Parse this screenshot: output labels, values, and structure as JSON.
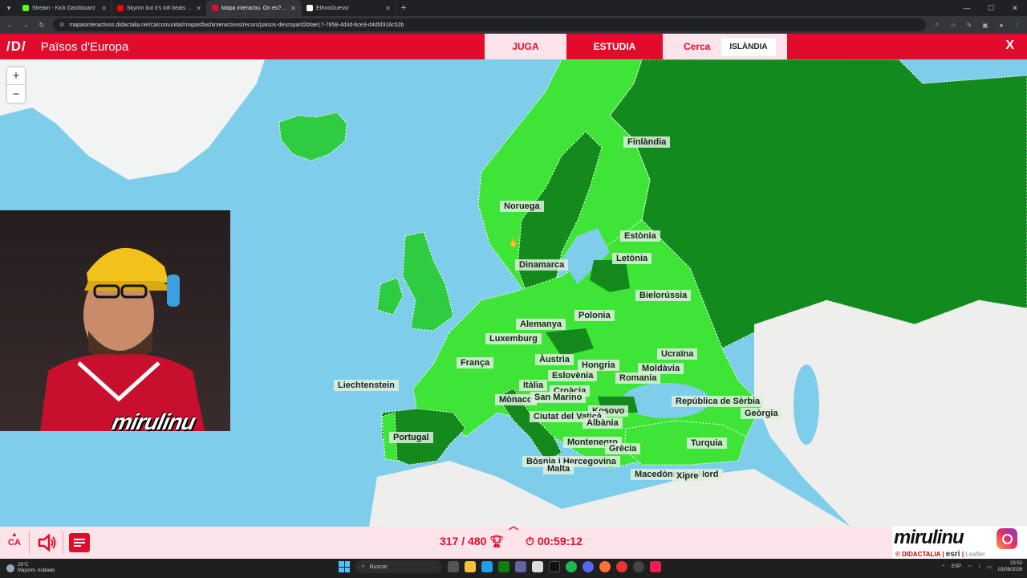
{
  "browser": {
    "tabs": [
      {
        "title": "Stream - Kick Dashboard",
        "color": "#53fc18",
        "active": false
      },
      {
        "title": "Skyrim but it's lofi beats | N",
        "color": "#ff0000",
        "active": false
      },
      {
        "title": "Mapa interactiu. On és? Països",
        "color": "#e10c2c",
        "active": true
      },
      {
        "title": "EthnoGuessr",
        "color": "#ffffff",
        "active": false
      }
    ],
    "url": "mapasinteractivos.didactalia.net/ca/comunitat/mapasflashinteractivos/recurs/paisos-deuropa/d2bfae17-7658-4d3d-bce3-d4d5f316c52b"
  },
  "app": {
    "logo": "/D/",
    "title": "Països d'Europa",
    "modes": {
      "play": "JUGA",
      "study": "ESTUDIA",
      "search": "Cerca"
    },
    "search_target": "ISLÀNDIA",
    "close": "X"
  },
  "map": {
    "zoom_in": "+",
    "zoom_out": "−",
    "labels": [
      "Finlàndia",
      "Noruega",
      "Estònia",
      "Letònia",
      "Dinamarca",
      "Bielorússia",
      "Polonia",
      "Alemanya",
      "Luxemburg",
      "Ucraïna",
      "Àustria",
      "Hongria",
      "França",
      "Moldàvia",
      "Eslovènia",
      "Liechtenstein",
      "Romania",
      "Itàlia",
      "Croàcia",
      "República de Sèrbia",
      "Mònaco",
      "San Marino",
      "Geòrgia",
      "Kosovo",
      "Ciutat del Vaticà",
      "Albània",
      "Portugal",
      "Montenegro",
      "Grècia",
      "Turquia",
      "Bòsnia i Hercegovina",
      "Malta",
      "Macedònia del Nord",
      "Xipre"
    ]
  },
  "overlay": {
    "streamer": "mirulinu"
  },
  "bottom": {
    "lang": "CA",
    "score": "317 / 480",
    "timer": "00:59:12",
    "credit_left": "© DIDACTALIA",
    "credit_right": "esri",
    "credit_small": "Leaflet"
  },
  "taskbar": {
    "temp": "26°C",
    "weather": "Mayorm. nublado",
    "search": "Buscar",
    "lang": "ESP",
    "time": "23:53",
    "date": "03/08/2026"
  }
}
